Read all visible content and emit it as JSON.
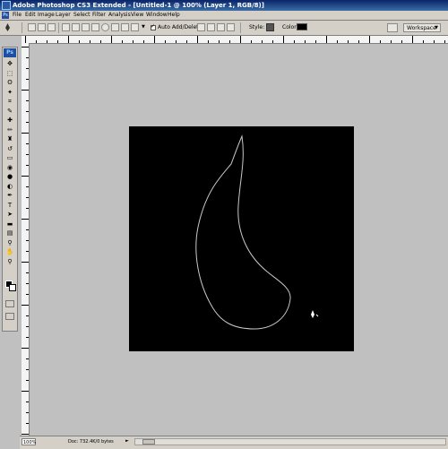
{
  "window": {
    "title": "Adobe Photoshop CS3 Extended - [Untitled-1 @ 100% (Layer 1, RGB/8)]"
  },
  "menu": {
    "logo": "Ps",
    "items": [
      "File",
      "Edit",
      "Image",
      "Layer",
      "Select",
      "Filter",
      "Analysis",
      "View",
      "Window",
      "Help"
    ]
  },
  "options_bar": {
    "auto_add_delete": {
      "label": "Auto Add/Delete",
      "checked": true
    },
    "style_label": "Style:",
    "color_label": "Color:",
    "color_value": "#000000",
    "workspace_label": "Workspace"
  },
  "toolbox": {
    "logo": "Ps",
    "tools": [
      "move-icon",
      "marquee-icon",
      "lasso-icon",
      "magic-wand-icon",
      "crop-icon",
      "slice-icon",
      "healing-brush-icon",
      "brush-icon",
      "clone-stamp-icon",
      "history-brush-icon",
      "eraser-icon",
      "paint-bucket-icon",
      "blur-icon",
      "dodge-icon",
      "pen-icon",
      "type-icon",
      "path-selection-icon",
      "shape-icon",
      "notes-icon",
      "eyedropper-icon",
      "hand-icon",
      "zoom-icon"
    ],
    "foreground_color": "#000000",
    "background_color": "#ffffff"
  },
  "canvas": {
    "background": "#000000",
    "path_stroke": "#c8c8c8"
  },
  "status_bar": {
    "zoom": "100%",
    "doc_info": "Doc: 732.4K/0 bytes"
  }
}
